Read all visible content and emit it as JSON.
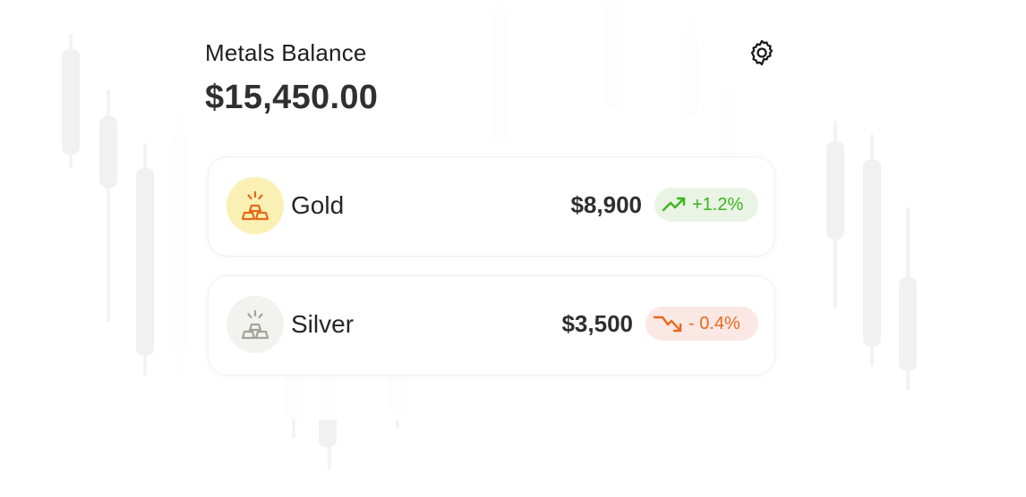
{
  "header": {
    "title": "Metals Balance",
    "balance": "$15,450.00"
  },
  "assets": [
    {
      "name": "Gold",
      "amount": "$8,900",
      "change": "+1.2%",
      "trend": "up",
      "icon": "gold-bars-icon",
      "accent": "#e36a1a",
      "icon_bg": "#fbf0b3",
      "badge_color": "#3cb41e",
      "badge_bg": "#e9f4e4"
    },
    {
      "name": "Silver",
      "amount": "$3,500",
      "change": "- 0.4%",
      "trend": "down",
      "icon": "silver-bars-icon",
      "accent": "#a3a39b",
      "icon_bg": "#f2f3ef",
      "badge_color": "#e56a1c",
      "badge_bg": "#fbe7e3"
    }
  ],
  "icons": {
    "settings": "gear-icon"
  }
}
